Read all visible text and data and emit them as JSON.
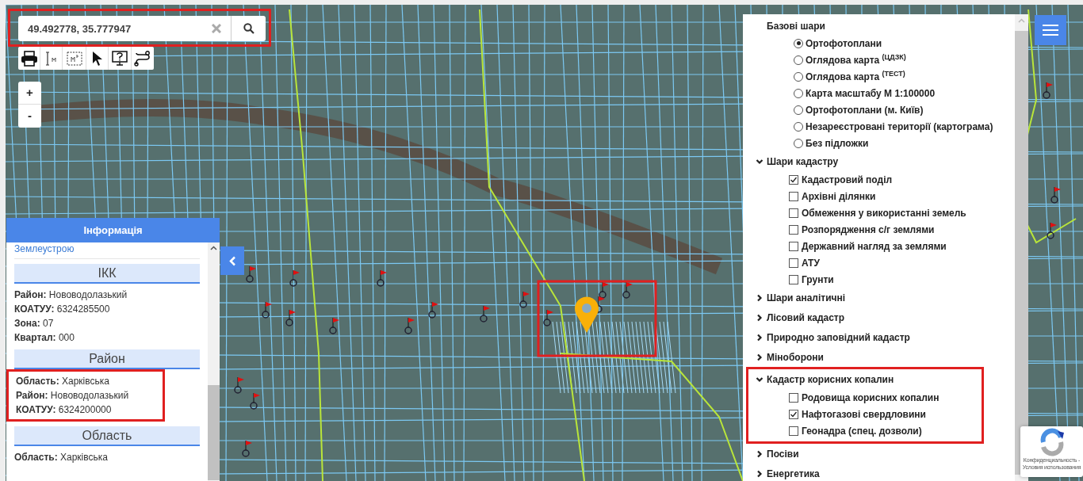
{
  "search": {
    "value": "49.492778, 35.777947",
    "highlighted": true
  },
  "zoom": {
    "in": "+",
    "out": "-"
  },
  "info_panel": {
    "title": "Інформація",
    "link": "Землеустрою",
    "sections": [
      {
        "heading": "ІКК",
        "highlighted": false,
        "fields": [
          {
            "label": "Район:",
            "value": "Нововодолазький"
          },
          {
            "label": "КОАТУУ:",
            "value": "6324285500"
          },
          {
            "label": "Зона:",
            "value": "07"
          },
          {
            "label": "Квартал:",
            "value": "000"
          }
        ]
      },
      {
        "heading": "Район",
        "highlighted": true,
        "fields": [
          {
            "label": "Область:",
            "value": "Харківська"
          },
          {
            "label": "Район:",
            "value": "Нововодолазький"
          },
          {
            "label": "КОАТУУ:",
            "value": "6324200000"
          }
        ]
      },
      {
        "heading": "Область",
        "highlighted": false,
        "fields": [
          {
            "label": "Область:",
            "value": "Харківська"
          }
        ]
      }
    ]
  },
  "layers": {
    "base_title": "Базові шари",
    "base_items": [
      {
        "label": "Ортофотоплани",
        "selected": true
      },
      {
        "label": "Оглядова карта $^{(ЦДЗК)}$",
        "selected": false
      },
      {
        "label": "Оглядова карта $^{(ТЕСТ)}$",
        "selected": false
      },
      {
        "label": "Карта масштабу М 1:100000",
        "selected": false
      },
      {
        "label": "Ортофотоплани (м. Київ)",
        "selected": false
      },
      {
        "label": "Незареєстровані території (картограма)",
        "selected": false
      },
      {
        "label": "Без підложки",
        "selected": false
      }
    ],
    "groups": [
      {
        "title": "Шари кадастру",
        "expanded": true,
        "highlighted": false,
        "items": [
          {
            "label": "Кадастровий поділ",
            "checked": true
          },
          {
            "label": "Архівні ділянки",
            "checked": false
          },
          {
            "label": "Обмеження у використанні земель",
            "checked": false
          },
          {
            "label": "Розпорядження с/г землями",
            "checked": false
          },
          {
            "label": "Державний нагляд за землями",
            "checked": false
          },
          {
            "label": "АТУ",
            "checked": false
          },
          {
            "label": "Грунти",
            "checked": false
          }
        ]
      },
      {
        "title": "Шари аналітичні",
        "expanded": false,
        "highlighted": false
      },
      {
        "title": "Лісовий кадастр",
        "expanded": false,
        "highlighted": false
      },
      {
        "title": "Природно заповідний кадастр",
        "expanded": false,
        "highlighted": false
      },
      {
        "title": "Міноборони",
        "expanded": false,
        "highlighted": false
      },
      {
        "title": "Кадастр корисних копалин",
        "expanded": true,
        "highlighted": true,
        "items": [
          {
            "label": "Родовища корисних копалин",
            "checked": false
          },
          {
            "label": "Нафтогазові свердловини",
            "checked": true
          },
          {
            "label": "Геонадра (спец. дозволи)",
            "checked": false
          }
        ]
      },
      {
        "title": "Посіви",
        "expanded": false,
        "highlighted": false
      },
      {
        "title": "Енергетика",
        "expanded": false,
        "highlighted": false
      }
    ]
  },
  "recaptcha": {
    "line_1": "Конфиденциальность -",
    "line_2": "Условия использования"
  }
}
